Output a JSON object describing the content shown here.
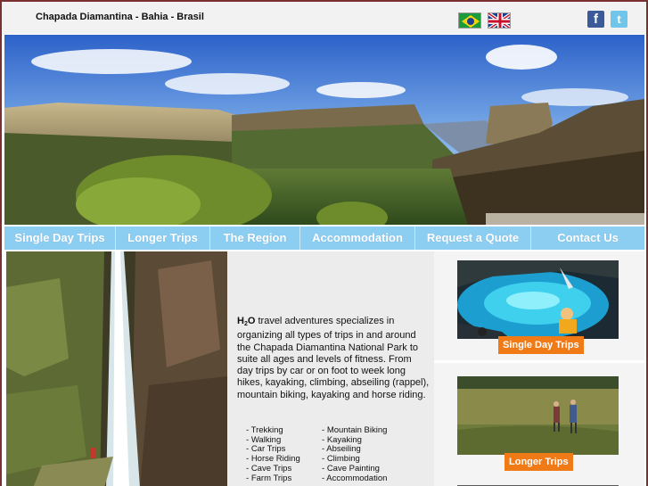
{
  "header": {
    "site_title": "Chapada Diamantina - Bahia - Brasil",
    "facebook_glyph": "f",
    "twitter_glyph": "t"
  },
  "nav": {
    "items": [
      {
        "label": "Single Day Trips"
      },
      {
        "label": "Longer Trips"
      },
      {
        "label": "The Region"
      },
      {
        "label": "Accommodation"
      },
      {
        "label": "Request a Quote"
      },
      {
        "label": "Contact Us"
      }
    ]
  },
  "intro": {
    "brand_h": "H",
    "brand_sub": "2",
    "brand_o": "O",
    "text": " travel adventures specializes in organizing all types of trips in and around the Chapada Diamantina National Park to suite all ages and levels of fitness. From day trips by car or on foot to week long hikes, kayaking, climbing, abseiling (rappel), mountain biking, kayaking and horse riding."
  },
  "activities": {
    "left": [
      "Trekking",
      "Walking",
      "Car Trips",
      "Horse Riding",
      "Cave Trips",
      "Farm Trips"
    ],
    "right": [
      "Mountain Biking",
      "Kayaking",
      "Abseiling",
      "Climbing",
      "Cave Painting",
      "Accommodation"
    ]
  },
  "promos": {
    "single_label": "Single Day Trips",
    "longer_label": "Longer Trips"
  },
  "colors": {
    "nav_bg": "#8ccdf2",
    "promo_button": "#f07a16",
    "frame_border": "#7a3030"
  },
  "icons": [
    "brazil-flag-icon",
    "uk-flag-icon",
    "facebook-icon",
    "twitter-icon"
  ]
}
